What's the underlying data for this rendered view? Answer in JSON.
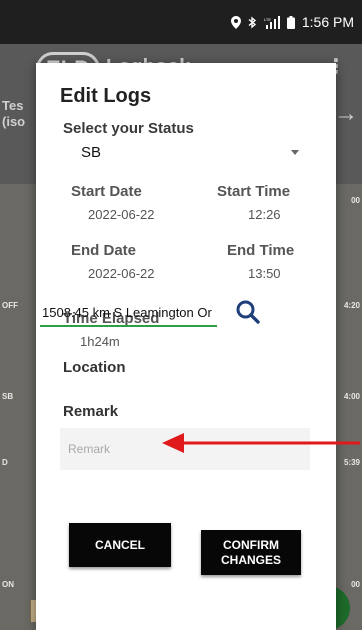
{
  "status_bar": {
    "time": "1:56 PM",
    "icons": [
      "location-pin-icon",
      "bluetooth-icon",
      "lte-signal-icon",
      "battery-icon"
    ]
  },
  "background_app": {
    "logo": "ELD",
    "title": "Logbook",
    "driver_text": "Tes\n(iso",
    "rows": [
      {
        "label": "OFF",
        "total": "4:20"
      },
      {
        "label": "SB",
        "total": "4:00"
      },
      {
        "label": "D",
        "total": "5:39"
      },
      {
        "label": "ON",
        "total": "00"
      }
    ],
    "top_total": "00"
  },
  "dialog": {
    "title": "Edit Logs",
    "status_label": "Select your Status",
    "status_value": "SB",
    "start_date_label": "Start Date",
    "start_date_value": "2022-06-22",
    "start_time_label": "Start Time",
    "start_time_value": "12:26",
    "end_date_label": "End Date",
    "end_date_value": "2022-06-22",
    "end_time_label": "End Time",
    "end_time_value": "13:50",
    "elapsed_label": "Time Elapsed",
    "elapsed_value": "1h24m",
    "location_label": "Location",
    "location_value": "1508.45 km S Leamington Or",
    "remark_label": "Remark",
    "remark_placeholder": "Remark",
    "cancel_label": "CANCEL",
    "confirm_label": "CONFIRM CHANGES"
  },
  "colors": {
    "accent_green": "#2e9d48",
    "annotation_red": "#e0191b",
    "button_black": "#070707"
  }
}
